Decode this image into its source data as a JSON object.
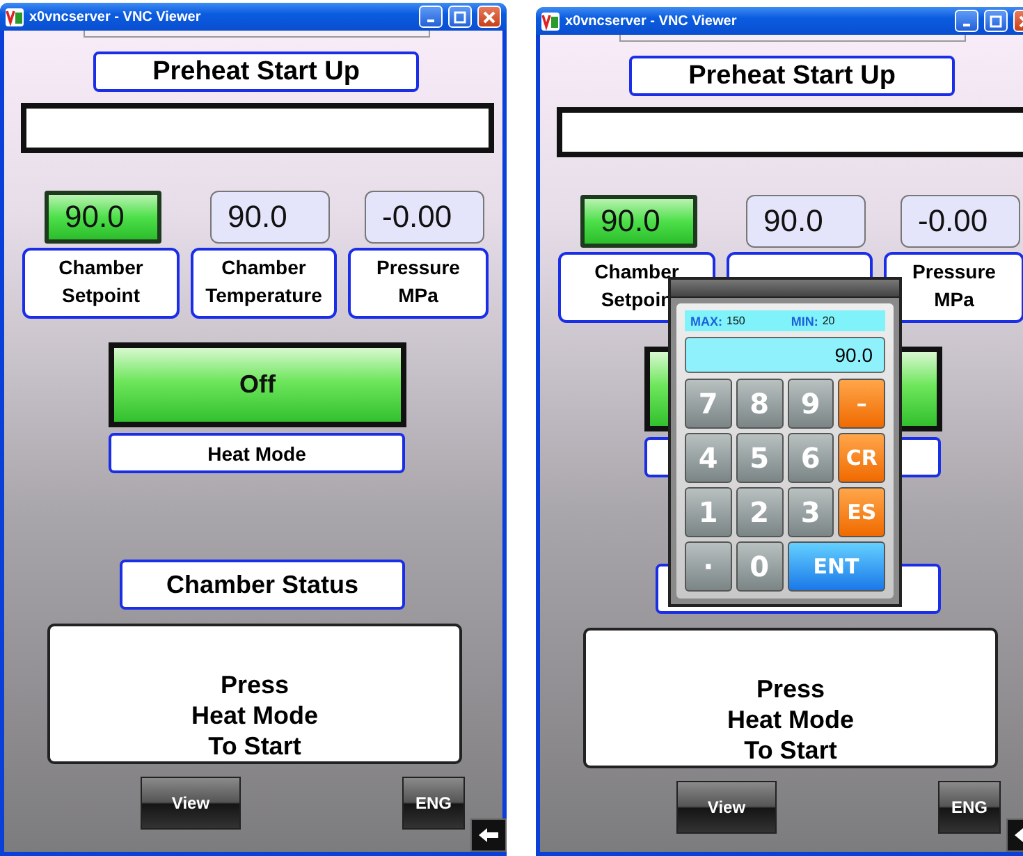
{
  "windows": [
    {
      "title": "x0vncserver - VNC Viewer",
      "header": "Preheat Start Up",
      "readings": [
        {
          "kind": "setpoint",
          "value": "90.0",
          "label_lines": [
            "Chamber",
            "Setpoint"
          ]
        },
        {
          "kind": "reading",
          "value": "90.0",
          "label_lines": [
            "Chamber",
            "Temperature"
          ]
        },
        {
          "kind": "reading",
          "value": "-0.00",
          "label_lines": [
            "Pressure",
            "MPa"
          ]
        }
      ],
      "heat_button": "Off",
      "heat_label": "Heat Mode",
      "status_title": "Chamber Status",
      "status_lines": [
        "Press",
        "Heat Mode",
        "To Start"
      ],
      "buttons": [
        "View",
        "ENG"
      ]
    },
    {
      "title": "x0vncserver - VNC Viewer",
      "header": "Preheat Start Up",
      "readings": [
        {
          "kind": "setpoint",
          "value": "90.0",
          "label_lines": [
            "Chamber",
            "Setpoin"
          ]
        },
        {
          "kind": "reading",
          "value": "90.0"
        },
        {
          "kind": "reading",
          "value": "-0.00",
          "label_lines": [
            "Pressure",
            "MPa"
          ]
        }
      ],
      "status_lines": [
        "Press",
        "Heat Mode",
        "To Start"
      ],
      "buttons": [
        "View",
        "ENG"
      ],
      "keypad": {
        "max_label": "MAX:",
        "max": "150",
        "min_label": "MIN:",
        "min": "20",
        "display": "90.0",
        "keys": [
          {
            "label": "7",
            "kind": "digit"
          },
          {
            "label": "8",
            "kind": "digit"
          },
          {
            "label": "9",
            "kind": "digit"
          },
          {
            "label": "–",
            "kind": "function"
          },
          {
            "label": "4",
            "kind": "digit"
          },
          {
            "label": "5",
            "kind": "digit"
          },
          {
            "label": "6",
            "kind": "digit"
          },
          {
            "label": "CR",
            "kind": "function"
          },
          {
            "label": "1",
            "kind": "digit"
          },
          {
            "label": "2",
            "kind": "digit"
          },
          {
            "label": "3",
            "kind": "digit"
          },
          {
            "label": "ES",
            "kind": "function"
          },
          {
            "label": "·",
            "kind": "digit"
          },
          {
            "label": "0",
            "kind": "digit"
          },
          {
            "label": "ENT",
            "kind": "enter"
          }
        ]
      }
    }
  ]
}
